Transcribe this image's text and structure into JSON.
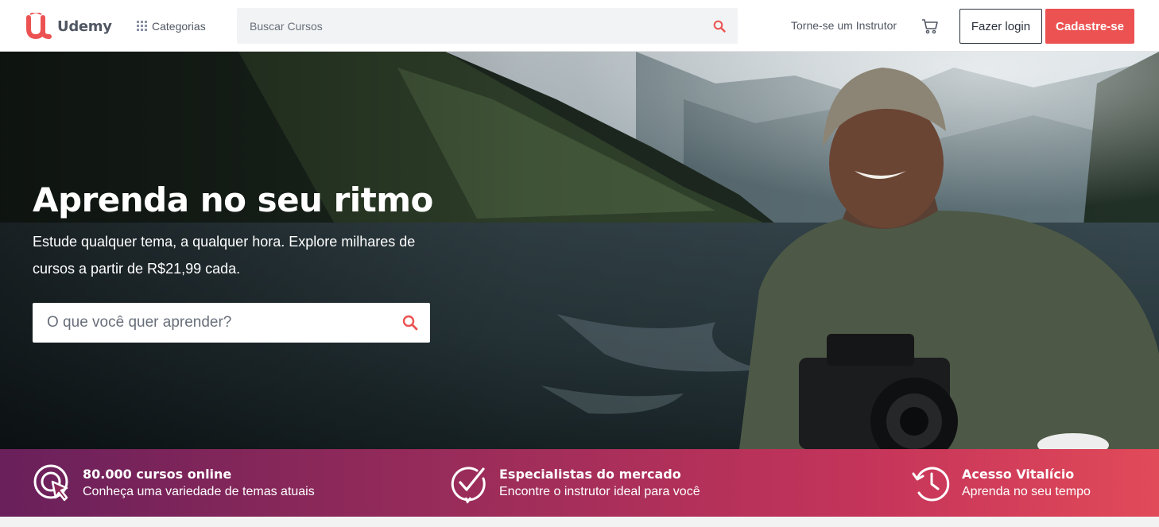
{
  "header": {
    "logo_text": "Udemy",
    "categories_label": "Categorias",
    "search_placeholder": "Buscar Cursos",
    "instructor_link": "Torne-se um Instrutor",
    "login_label": "Fazer login",
    "signup_label": "Cadastre-se",
    "icons": {
      "logo": "udemy-logo-icon",
      "categories": "grid-icon",
      "search": "search-icon",
      "cart": "cart-icon"
    }
  },
  "hero": {
    "title": "Aprenda no seu ritmo",
    "subtitle": "Estude qualquer tema, a qualquer hora. Explore milhares de cursos a partir de R$21,99 cada.",
    "search_placeholder": "O que você quer aprender?"
  },
  "features": [
    {
      "icon": "cursor-target-icon",
      "title": "80.000 cursos online",
      "description": "Conheça uma variedade de temas atuais"
    },
    {
      "icon": "check-badge-icon",
      "title": "Especialistas do mercado",
      "description": "Encontre o instrutor ideal para você"
    },
    {
      "icon": "clock-history-icon",
      "title": "Acesso Vitalício",
      "description": "Aprenda no seu tempo"
    }
  ],
  "colors": {
    "brand": "#ec5252",
    "text_dark": "#29303b",
    "text_muted": "#505763",
    "strip_start": "#69205b",
    "strip_end": "#e14a59"
  }
}
